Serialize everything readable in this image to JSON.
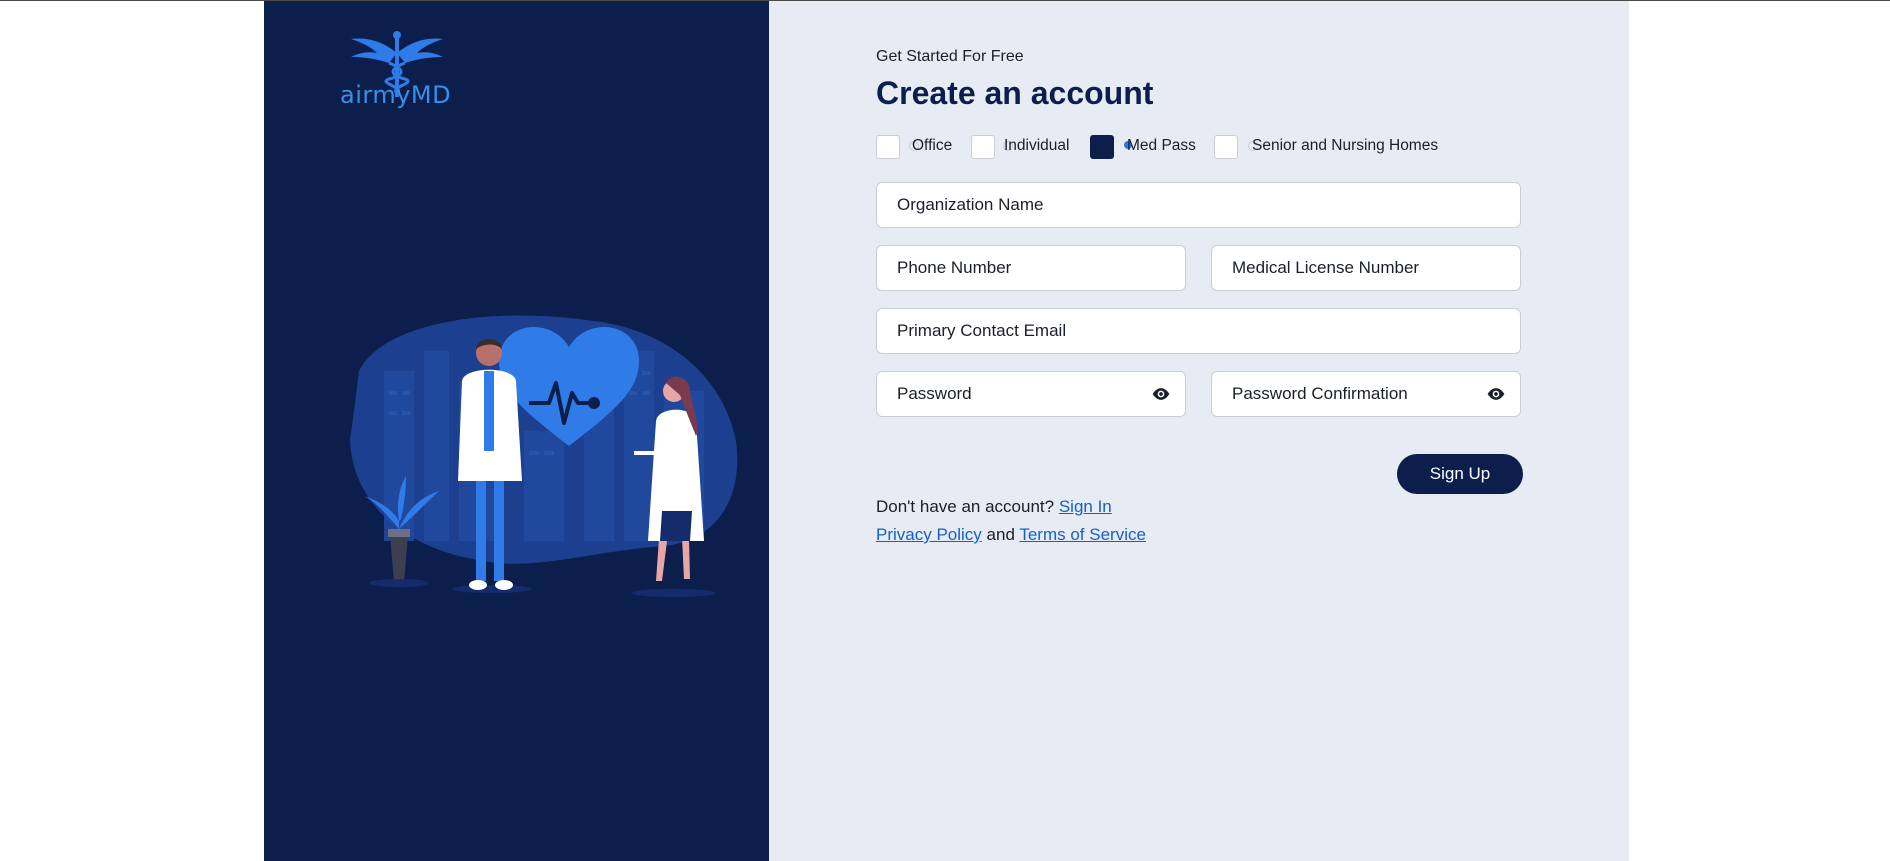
{
  "brand": {
    "logo_text": "airmyMD",
    "colors": {
      "navy": "#0c1e4c",
      "accent_blue": "#2f7be8",
      "panel_bg": "#e7ebf3",
      "link": "#1560c8"
    }
  },
  "form": {
    "subtitle": "Get Started For Free",
    "title": "Create an account",
    "account_types": [
      {
        "label": "Office",
        "checked": false
      },
      {
        "label": "Individual",
        "checked": false
      },
      {
        "label": "Med Pass",
        "checked": true
      },
      {
        "label": "Senior and Nursing Homes",
        "checked": false
      }
    ],
    "fields": {
      "organization_name": {
        "placeholder": "Organization Name",
        "value": ""
      },
      "phone_number": {
        "placeholder": "Phone Number",
        "value": ""
      },
      "medical_license_number": {
        "placeholder": "Medical License Number",
        "value": ""
      },
      "primary_contact_email": {
        "placeholder": "Primary Contact Email",
        "value": ""
      },
      "password": {
        "placeholder": "Password",
        "value": ""
      },
      "password_confirmation": {
        "placeholder": "Password Confirmation",
        "value": ""
      }
    },
    "icons": {
      "password_toggle": "eye-icon",
      "password_confirmation_toggle": "eye-icon"
    },
    "signup_label": "Sign Up",
    "no_account_text": "Don't have an account?",
    "signin_link": "Sign In",
    "privacy_link": "Privacy Policy",
    "and_text": "and",
    "terms_link": "Terms of Service"
  }
}
